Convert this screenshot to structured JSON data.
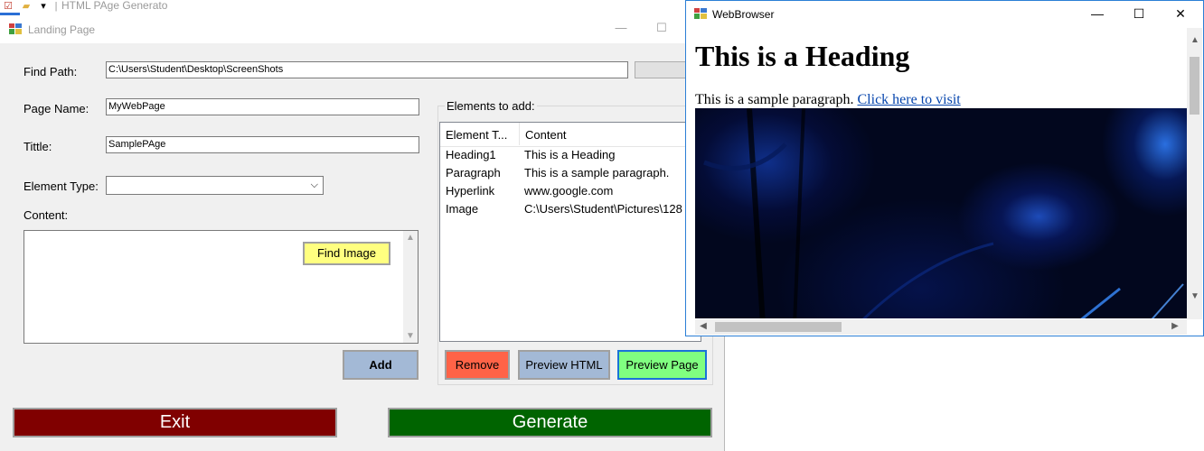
{
  "background_app": {
    "title": "HTML PAge Generato"
  },
  "landing": {
    "window_title": "Landing Page",
    "find_path": {
      "label": "Find Path:",
      "value": "C:\\Users\\Student\\Desktop\\ScreenShots",
      "browse_label": "..."
    },
    "page_name": {
      "label": "Page Name:",
      "value": "MyWebPage"
    },
    "title_field": {
      "label": "Tittle:",
      "value": "SamplePAge"
    },
    "element_type": {
      "label": "Element Type:",
      "value": ""
    },
    "content": {
      "label": "Content:",
      "value": ""
    },
    "find_image_label": "Find Image",
    "add_label": "Add",
    "elements_group_label": "Elements to add:",
    "elements_columns": [
      "Element T...",
      "Content"
    ],
    "elements_rows": [
      {
        "type": "Heading1",
        "content": "This is a Heading"
      },
      {
        "type": "Paragraph",
        "content": "This is a sample paragraph."
      },
      {
        "type": "Hyperlink",
        "content": "www.google.com"
      },
      {
        "type": "Image",
        "content": "C:\\Users\\Student\\Pictures\\128"
      }
    ],
    "remove_label": "Remove",
    "preview_html_label": "Preview HTML",
    "preview_page_label": "Preview Page",
    "exit_label": "Exit",
    "generate_label": "Generate",
    "colors": {
      "find_image": "#ffff80",
      "add": "#a3b9d6",
      "remove": "#ff6347",
      "preview_html": "#a3b9d6",
      "preview_page": "#80ff80",
      "exit": "#800000",
      "generate": "#006400"
    }
  },
  "browser": {
    "window_title": "WebBrowser",
    "heading": "This is a Heading",
    "paragraph": "This is a sample paragraph.",
    "link_text": "Click here to visit"
  }
}
